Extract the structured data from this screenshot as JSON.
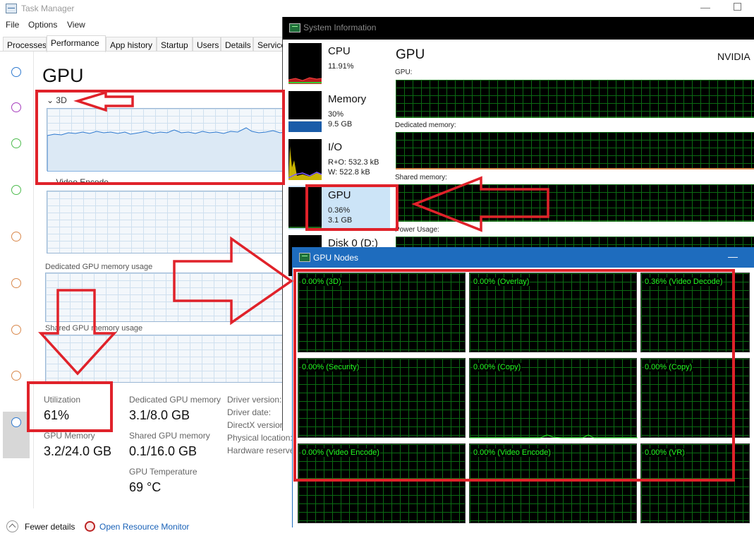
{
  "colors": {
    "accent": "#e0222a",
    "graph_green": "#22ff22",
    "tm_blue": "#1a62b8",
    "gpu_nodes_title_bg": "#1e6cbe"
  },
  "task_manager": {
    "title": "Task Manager",
    "menu": [
      "File",
      "Options",
      "View"
    ],
    "tabs": [
      "Processes",
      "Performance",
      "App history",
      "Startup",
      "Users",
      "Details",
      "Services"
    ],
    "active_tab": "Performance",
    "sidebar_circles": [
      "#2f7ad0",
      "#a63cbd",
      "#4cbb4c",
      "#4cbb4c",
      "#d9884b",
      "#d9884b",
      "#d9884b",
      "#d9884b",
      "#2f7ad0"
    ],
    "heading": "GPU",
    "graphs": {
      "g3d": "3D",
      "video_encode": "Video Encode",
      "dedicated": "Dedicated GPU memory usage",
      "shared": "Shared GPU memory usage"
    },
    "stats": {
      "utilization_label": "Utilization",
      "utilization_value": "61%",
      "gpu_memory_label": "GPU Memory",
      "gpu_memory_value": "3.2/24.0 GB",
      "dedicated_label": "Dedicated GPU memory",
      "dedicated_value": "3.1/8.0 GB",
      "shared_label": "Shared GPU memory",
      "shared_value": "0.1/16.0 GB",
      "temperature_label": "GPU Temperature",
      "temperature_value": "69 °C"
    },
    "info_labels": [
      "Driver version:",
      "Driver date:",
      "DirectX version:",
      "Physical location:",
      "Hardware reserved"
    ],
    "footer": {
      "fewer_details": "Fewer details",
      "resource_monitor": "Open Resource Monitor"
    }
  },
  "system_information": {
    "title": "System Information",
    "items": [
      {
        "name": "CPU",
        "line1": "11.91%",
        "line2": ""
      },
      {
        "name": "Memory",
        "line1": "30%",
        "line2": "9.5 GB"
      },
      {
        "name": "I/O",
        "line1": "R+O: 532.3 kB",
        "line2": "W: 522.8 kB"
      },
      {
        "name": "GPU",
        "line1": "0.36%",
        "line2": "3.1 GB"
      },
      {
        "name": "Disk 0 (D:)",
        "line1": "",
        "line2": ""
      }
    ],
    "heading": "GPU",
    "vendor": "NVIDIA",
    "graph_labels": [
      "GPU:",
      "Dedicated memory:",
      "Shared memory:",
      "Power Usage:"
    ]
  },
  "gpu_nodes": {
    "title": "GPU Nodes",
    "nodes": [
      "0.00% (3D)",
      "0.00% (Overlay)",
      "0.36% (Video Decode)",
      "0.00% (Security)",
      "0.00% (Copy)",
      "0.00% (Copy)",
      "0.00% (Video Encode)",
      "0.00% (Video Encode)",
      "0.00% (VR)"
    ]
  }
}
